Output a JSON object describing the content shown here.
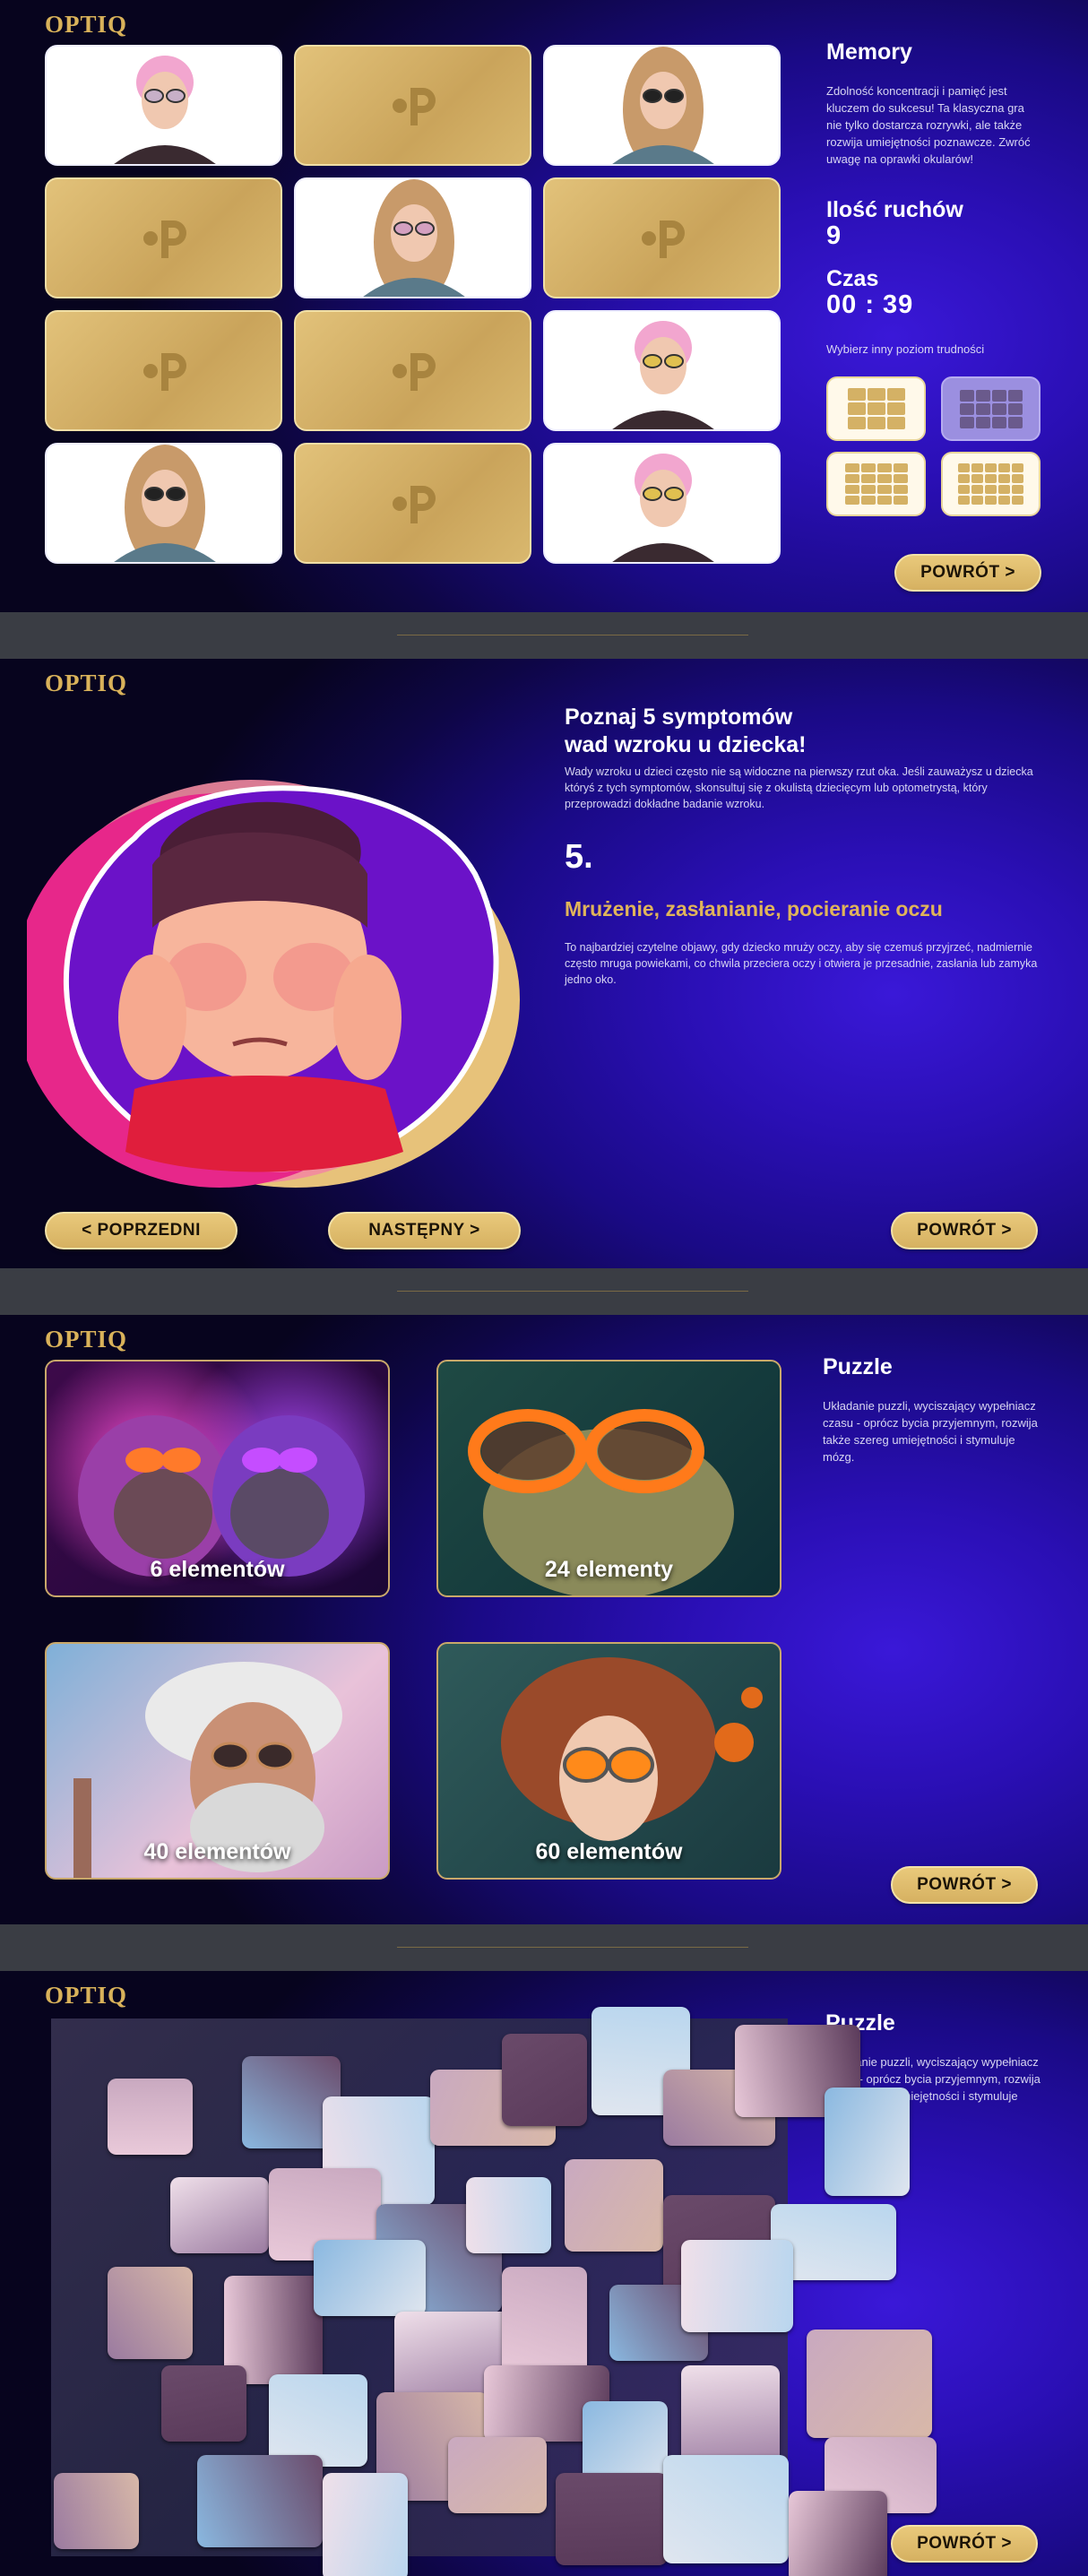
{
  "brand": {
    "logo": "OPTIQ",
    "gold": "#d9b25a",
    "bg_dark": "#0e0645",
    "bg_accent": "#2a0fb4"
  },
  "memory": {
    "title": "Memory",
    "description": "Zdolność koncentracji i pamięć jest kluczem do sukcesu! Ta klasyczna gra nie tylko dostarcza rozrywki, ale także rozwija umiejętności poznawcze. Zwróć uwagę na oprawki okularów!",
    "moves_label": "Ilość ruchów",
    "moves_value": "9",
    "time_label": "Czas",
    "time_value": "00 : 39",
    "difficulty_label": "Wybierz inny poziom trudności",
    "back_button": "POWRÓT >",
    "cards": [
      "face-pink-hair-round-glasses",
      "back",
      "face-long-hair-sunglasses",
      "back",
      "face-long-hair-pink-glasses",
      "back",
      "back",
      "back",
      "face-pink-hair-yellow-glasses",
      "face-long-hair-sunglasses",
      "back",
      "face-pink-hair-yellow-glasses"
    ]
  },
  "symptoms": {
    "title_line1": "Poznaj 5 symptomów",
    "title_line2": "wad wzroku u dziecka!",
    "intro": "Wady wzroku u dzieci często nie są widoczne na pierwszy rzut oka. Jeśli zauważysz u dziecka któryś z tych symptomów, skonsultuj się z okulistą dziecięcym lub optometrystą, który przeprowadzi dokładne badanie wzroku.",
    "number": "5.",
    "symptom_title": "Mrużenie, zasłanianie, pocieranie oczu",
    "symptom_desc": "To najbardziej czytelne objawy, gdy dziecko mruży oczy, aby się czemuś przyjrzeć, nadmiernie często mruga powiekami, co chwila przeciera oczy i otwiera je przesadnie, zasłania lub zamyka jedno oko.",
    "prev_button": "< POPRZEDNI",
    "next_button": "NASTĘPNY >",
    "back_button": "POWRÓT >"
  },
  "puzzle_select": {
    "title": "Puzzle",
    "description": "Układanie puzzli, wyciszający wypełniacz czasu - oprócz bycia przyjemnym, rozwija także szereg umiejętności i stymuluje mózg.",
    "options": [
      {
        "label": "6 elementów",
        "image": "hedgehogs-sunglasses"
      },
      {
        "label": "24 elementy",
        "image": "iguana-orange-sunglasses"
      },
      {
        "label": "40 elementów",
        "image": "old-man-sunglasses"
      },
      {
        "label": "60 elementów",
        "image": "curly-woman-orange-glasses"
      }
    ],
    "back_button": "POWRÓT >"
  },
  "puzzle_game": {
    "title": "Puzzle",
    "description": "Układanie puzzli, wyciszający wypełniacz czasu - oprócz bycia przyjemnym, rozwija także szereg umiejętności i stymuluje mózg.",
    "back_button": "POWRÓT >"
  }
}
